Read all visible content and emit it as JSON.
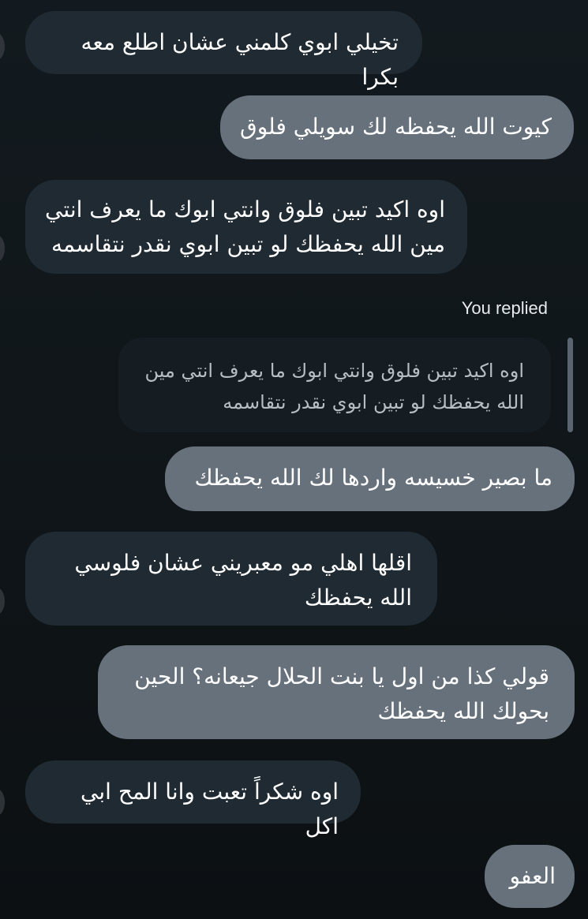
{
  "messages": [
    {
      "dir": "in",
      "text": "تخيلي ابوي كلمني عشان اطلع معه بكرا"
    },
    {
      "dir": "out",
      "text": "كيوت الله يحفظه لك سويلي فلوق"
    },
    {
      "dir": "in",
      "text": "اوه اكيد تبين فلوق وانتي ابوك ما يعرف انتي مين الله يحفظك لو تبين ابوي نقدر نتقاسمه"
    },
    {
      "dir": "out",
      "text": "ما بصير خسيسه واردها لك الله يحفظك"
    },
    {
      "dir": "in",
      "text": "اقلها اهلي مو معبريني عشان فلوسي الله يحفظك"
    },
    {
      "dir": "out",
      "text": "قولي كذا من اول يا بنت الحلال جيعانه؟ الحين بحولك الله يحفظك"
    },
    {
      "dir": "in",
      "text": "اوه شكراً تعبت وانا المح ابي اكل"
    },
    {
      "dir": "out",
      "text": "العفو"
    }
  ],
  "reply": {
    "label": "You replied",
    "quoted_text": "اوه اكيد تبين فلوق وانتي ابوك ما يعرف انتي مين الله يحفظك لو تبين ابوي نقدر نتقاسمه"
  },
  "colors": {
    "background": "#111719",
    "incoming_bubble": "#1f2a32",
    "outgoing_bubble": "#67717b",
    "reply_quote_bg": "#161d22",
    "reply_bar": "#5b6570"
  }
}
